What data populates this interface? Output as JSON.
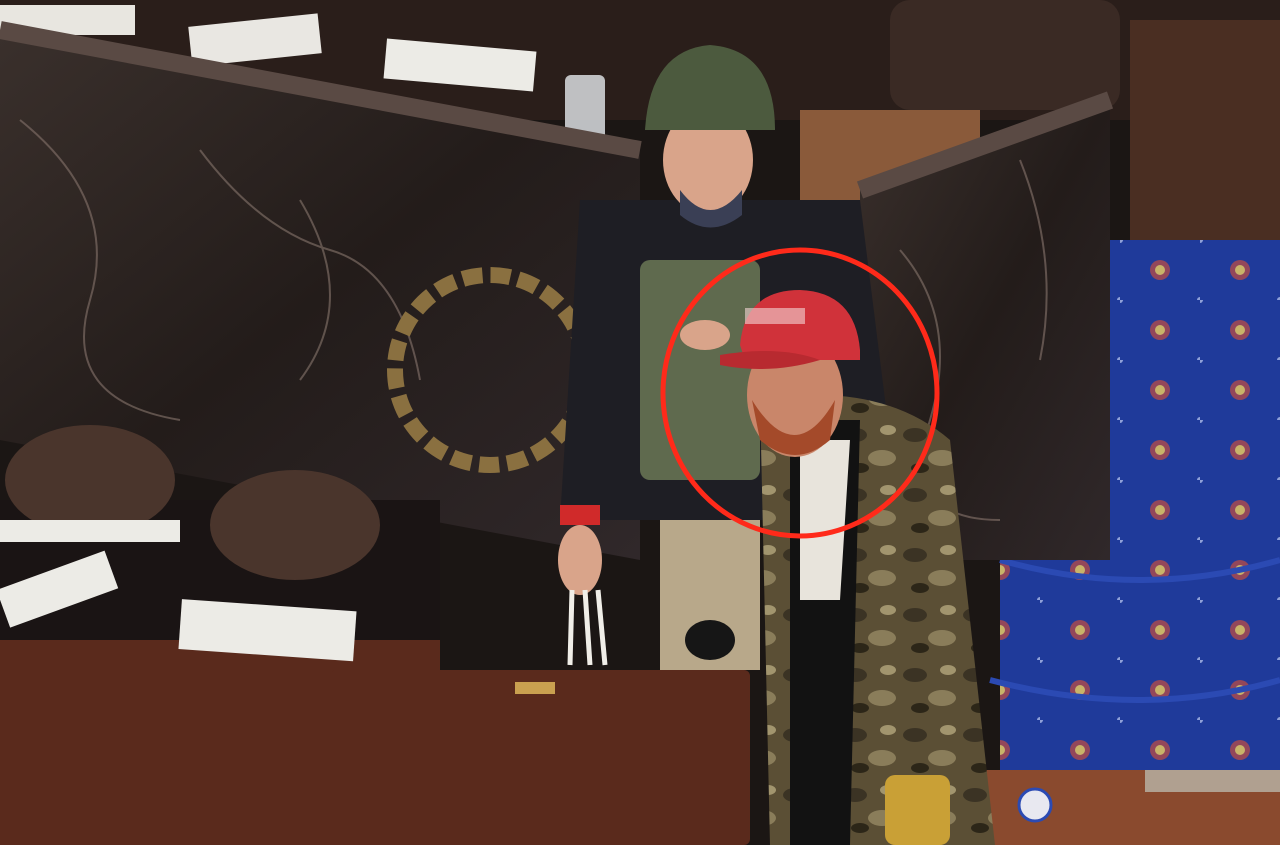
{
  "image": {
    "description_free": true
  },
  "colors": {
    "marble_dark": "#2a2220",
    "marble_vein": "#7a6a62",
    "carpet_blue": "#1f3a9a",
    "carpet_pattern": "#c9b46a",
    "desk_wood": "#5a2a1c",
    "desk_top": "#1a1414",
    "chair_leather": "#4a352c",
    "helmet_green": "#4c5a3e",
    "cap_red": "#d0323a",
    "camo_jacket": "#5b4f35",
    "highlight_circle": "#ff2a1a"
  },
  "icons": {
    "desk_seal": "round-seal-icon",
    "nameplate": "brass-plate-icon"
  }
}
